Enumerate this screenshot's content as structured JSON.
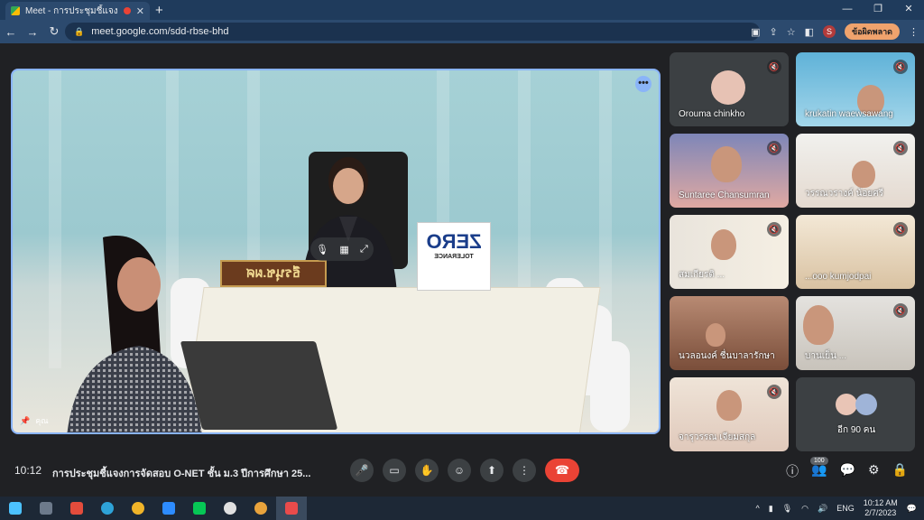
{
  "browser": {
    "tab_title": "Meet - การประชุมชี้แจงการจัดส...",
    "tab_close": "✕",
    "new_tab": "+",
    "url": "meet.google.com/sdd-rbse-bhd",
    "profile_initial": "S",
    "update_button": "ข้อผิดพลาด"
  },
  "meeting": {
    "time": "10:12",
    "title": "การประชุมชี้แจงการจัดสอบ O-NET ชั้น ม.3 ปีการศึกษา 25...",
    "participant_count": "100",
    "main_name": "คุณ",
    "main_more": "•••",
    "nameplate": "ธีรนุช.ผศ",
    "sign_text": "ZERO",
    "sign_sub": "TOLERANCE"
  },
  "participants": [
    {
      "name": "Orouma chinkho"
    },
    {
      "name": "krukatin waewsawang"
    },
    {
      "name": "Suntaree Chansumran"
    },
    {
      "name": "วรรณวรางค์ น้อยศรี"
    },
    {
      "name": "สมเกียรติ ..."
    },
    {
      "name": "...ooo kumjodpai"
    },
    {
      "name": "นวลอนงค์ ชื่นบาลารักษา"
    },
    {
      "name": "บานเย็น ..."
    },
    {
      "name": "จารุวรรณ เจียมสกุล"
    }
  ],
  "others": {
    "label": "อีก 90 คน"
  },
  "taskbar": {
    "lang": "ENG",
    "clock_time": "10:12 AM",
    "clock_date": "2/7/2023"
  },
  "icons": {
    "mic": "🎤",
    "cam": "▭",
    "hand": "✋",
    "emoji": "☺",
    "present": "⬆",
    "more": "⋮",
    "end": "☎",
    "info": "ⓘ",
    "people": "👥",
    "chat": "💬",
    "activities": "⚙",
    "host": "🔒"
  },
  "colors": {
    "accent": "#8ab4f8",
    "end_call": "#ea4335",
    "bg": "#202124"
  }
}
